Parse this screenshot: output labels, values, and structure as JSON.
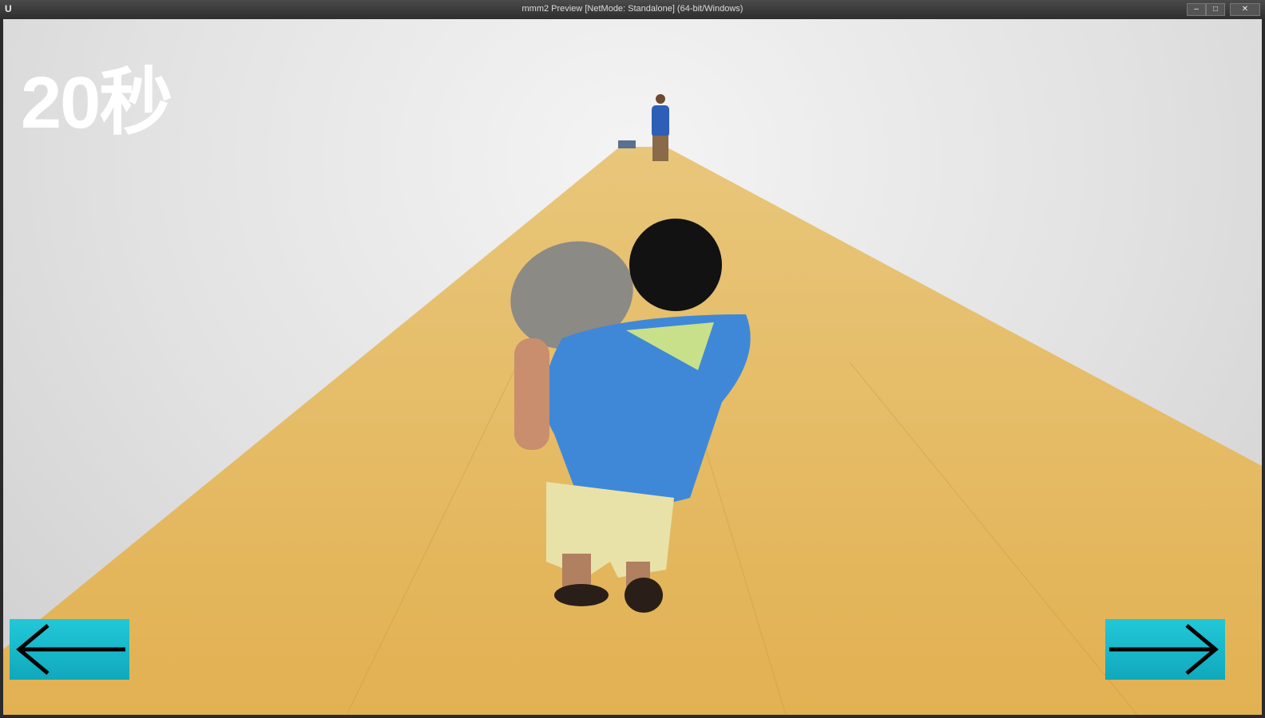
{
  "window": {
    "title": "mmm2 Preview [NetMode: Standalone] (64-bit/Windows)",
    "logo": "U",
    "minimize": "–",
    "maximize": "□",
    "close": "✕"
  },
  "hud": {
    "timer": "20秒"
  },
  "controls": {
    "left_icon": "arrow-left-icon",
    "right_icon": "arrow-right-icon"
  },
  "colors": {
    "road": "#e5b85c",
    "button": "#18bccf",
    "sky": "#e6e6e6"
  }
}
